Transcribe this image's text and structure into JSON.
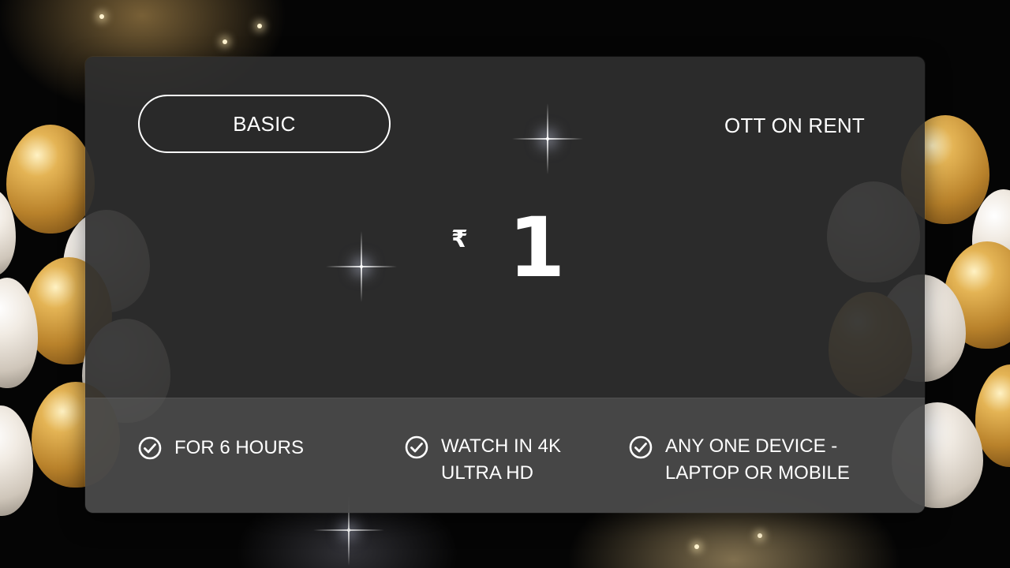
{
  "plan": {
    "name": "BASIC",
    "type": "OTT ON RENT"
  },
  "price": {
    "currency_symbol": "₹",
    "amount": "1"
  },
  "features": [
    {
      "line1": "FOR 6 HOURS",
      "line2": "",
      "icon": "check-circle-icon"
    },
    {
      "line1": "WATCH IN 4K",
      "line2": "ULTRA HD",
      "icon": "check-circle-icon"
    },
    {
      "line1": "ANY ONE DEVICE -",
      "line2": "LAPTOP OR MOBILE",
      "icon": "check-circle-icon"
    }
  ],
  "colors": {
    "card_background": "#2e2e2e",
    "feature_strip": "#5c5c5c",
    "text": "#ffffff",
    "balloon_gold": "#d9a545",
    "balloon_white": "#f1ebe3"
  }
}
